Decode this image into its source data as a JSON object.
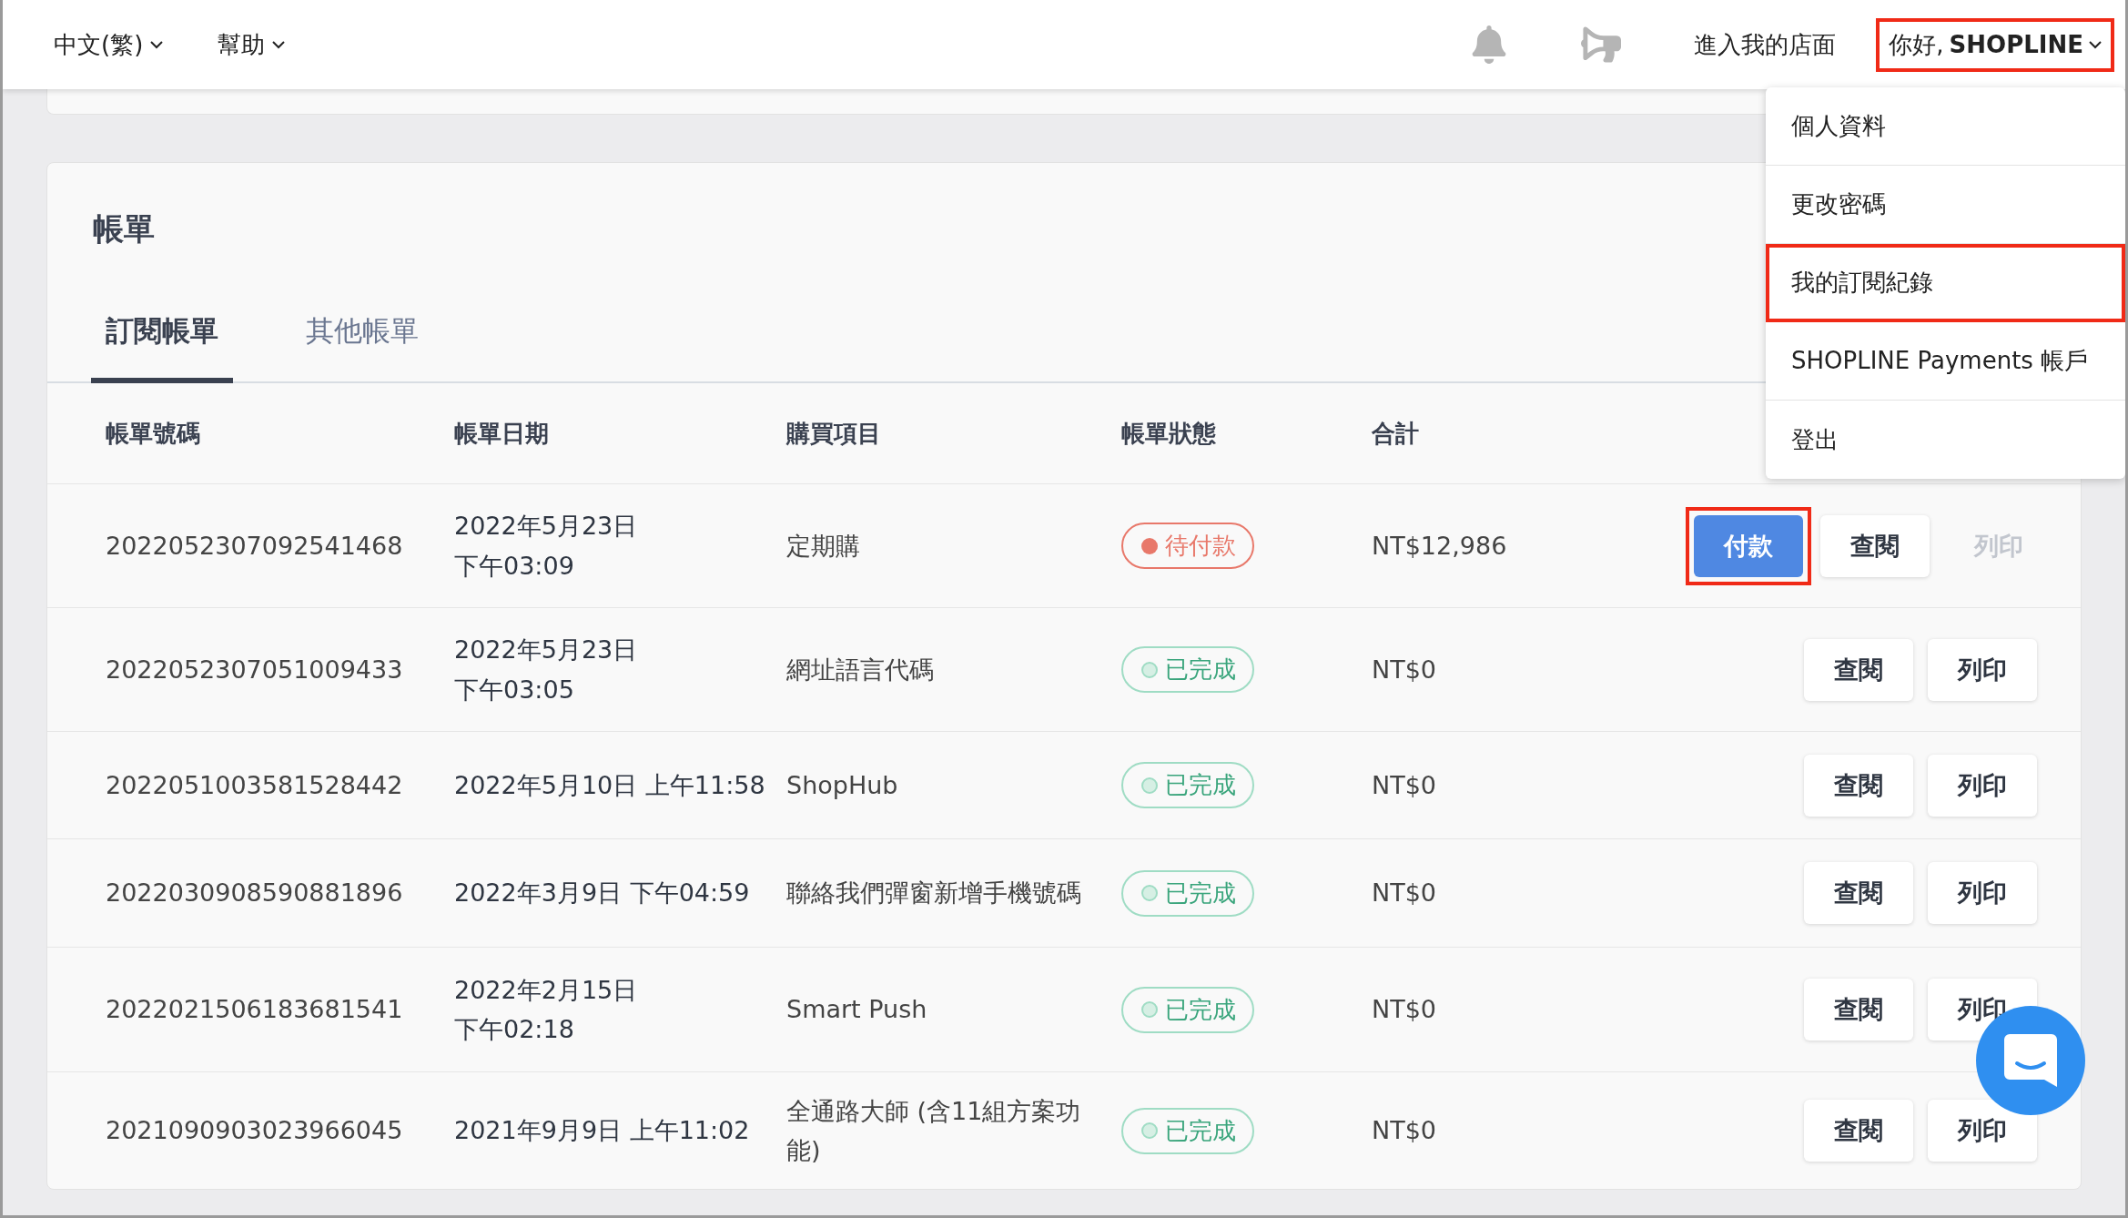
{
  "top_bar": {
    "language": "中文(繁)",
    "help": "幫助",
    "store_link": "進入我的店面",
    "user_menu": {
      "greeting": "你好,",
      "name": "SHOPLINE",
      "highlighted": true,
      "expanded": true
    }
  },
  "user_dropdown": [
    {
      "label": "個人資料",
      "highlighted": false
    },
    {
      "label": "更改密碼",
      "highlighted": false
    },
    {
      "label": "我的訂閱紀錄",
      "highlighted": true
    },
    {
      "label": "SHOPLINE Payments 帳戶",
      "highlighted": false
    },
    {
      "label": "登出",
      "highlighted": false
    }
  ],
  "billing": {
    "title": "帳單",
    "tabs": [
      {
        "label": "訂閱帳單",
        "selected": true
      },
      {
        "label": "其他帳單",
        "selected": false
      }
    ],
    "columns": [
      "帳單號碼",
      "帳單日期",
      "購買項目",
      "帳單狀態",
      "合計"
    ],
    "rows": [
      {
        "number": "2022052307092541468",
        "date": [
          "2022年5月23日",
          "下午03:09"
        ],
        "item": [
          "定期購"
        ],
        "status": {
          "kind": "pending",
          "label": "待付款"
        },
        "total": "NT$12,986",
        "pay": {
          "label": "付款",
          "highlighted": true
        },
        "view": "查閱",
        "print": {
          "label": "列印",
          "disabled": true
        }
      },
      {
        "number": "2022052307051009433",
        "date": [
          "2022年5月23日",
          "下午03:05"
        ],
        "item": [
          "網址語言代碼"
        ],
        "status": {
          "kind": "done",
          "label": "已完成"
        },
        "total": "NT$0",
        "view": "查閱",
        "print": {
          "label": "列印",
          "disabled": false
        }
      },
      {
        "number": "2022051003581528442",
        "date": [
          "2022年5月10日 上午11:58"
        ],
        "item": [
          "ShopHub"
        ],
        "status": {
          "kind": "done",
          "label": "已完成"
        },
        "total": "NT$0",
        "view": "查閱",
        "print": {
          "label": "列印",
          "disabled": false
        }
      },
      {
        "number": "2022030908590881896",
        "date": [
          "2022年3月9日 下午04:59"
        ],
        "item": [
          "聯絡我們彈窗新增手機號碼"
        ],
        "status": {
          "kind": "done",
          "label": "已完成"
        },
        "total": "NT$0",
        "view": "查閱",
        "print": {
          "label": "列印",
          "disabled": false
        }
      },
      {
        "number": "2022021506183681541",
        "date": [
          "2022年2月15日",
          "下午02:18"
        ],
        "item": [
          "Smart Push"
        ],
        "status": {
          "kind": "done",
          "label": "已完成"
        },
        "total": "NT$0",
        "view": "查閱",
        "print": {
          "label": "列印",
          "disabled": false
        }
      },
      {
        "number": "2021090903023966045",
        "date": [
          "2021年9月9日 上午11:02"
        ],
        "item": [
          "全通路大師 (含11組方案功",
          "能)"
        ],
        "status": {
          "kind": "done",
          "label": "已完成"
        },
        "total": "NT$0",
        "view": "查閱",
        "print": {
          "label": "列印",
          "disabled": false
        }
      }
    ]
  }
}
